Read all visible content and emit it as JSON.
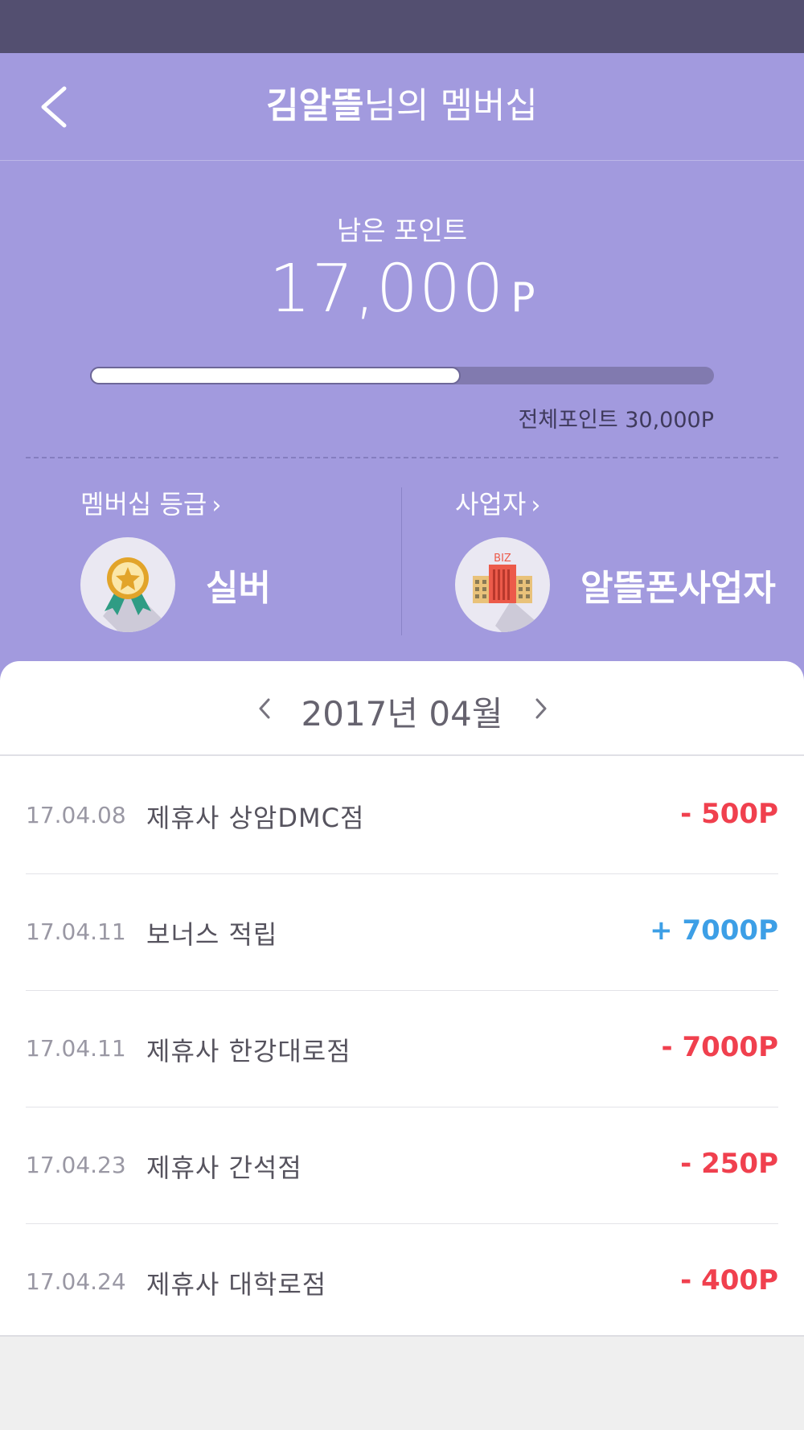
{
  "header": {
    "name_bold": "김알뜰",
    "title_suffix": "님의 멤버십"
  },
  "points": {
    "remaining_label": "남은 포인트",
    "remaining_value": "17,000",
    "unit": "P",
    "progress_fraction": 0.5946,
    "total_label": "전체포인트 30,000P"
  },
  "membership": {
    "grade_link": "멤버십 등급",
    "grade_value": "실버",
    "grade_icon": "medal-icon",
    "biz_link": "사업자",
    "biz_value": "알뜰폰사업자",
    "biz_icon": "building-icon",
    "biz_icon_text": "BIZ"
  },
  "month_nav": {
    "label": "2017년 04월"
  },
  "colors": {
    "minus": "#f0404e",
    "plus": "#3d9fe6"
  },
  "transactions": [
    {
      "date": "17.04.08",
      "desc": "제휴사 상암DMC점",
      "amount": "- 500P",
      "type": "minus"
    },
    {
      "date": "17.04.11",
      "desc": "보너스 적립",
      "amount": "+ 7000P",
      "type": "plus"
    },
    {
      "date": "17.04.11",
      "desc": "제휴사 한강대로점",
      "amount": "- 7000P",
      "type": "minus"
    },
    {
      "date": "17.04.23",
      "desc": "제휴사 간석점",
      "amount": "- 250P",
      "type": "minus"
    },
    {
      "date": "17.04.24",
      "desc": "제휴사 대학로점",
      "amount": "- 400P",
      "type": "minus"
    }
  ]
}
